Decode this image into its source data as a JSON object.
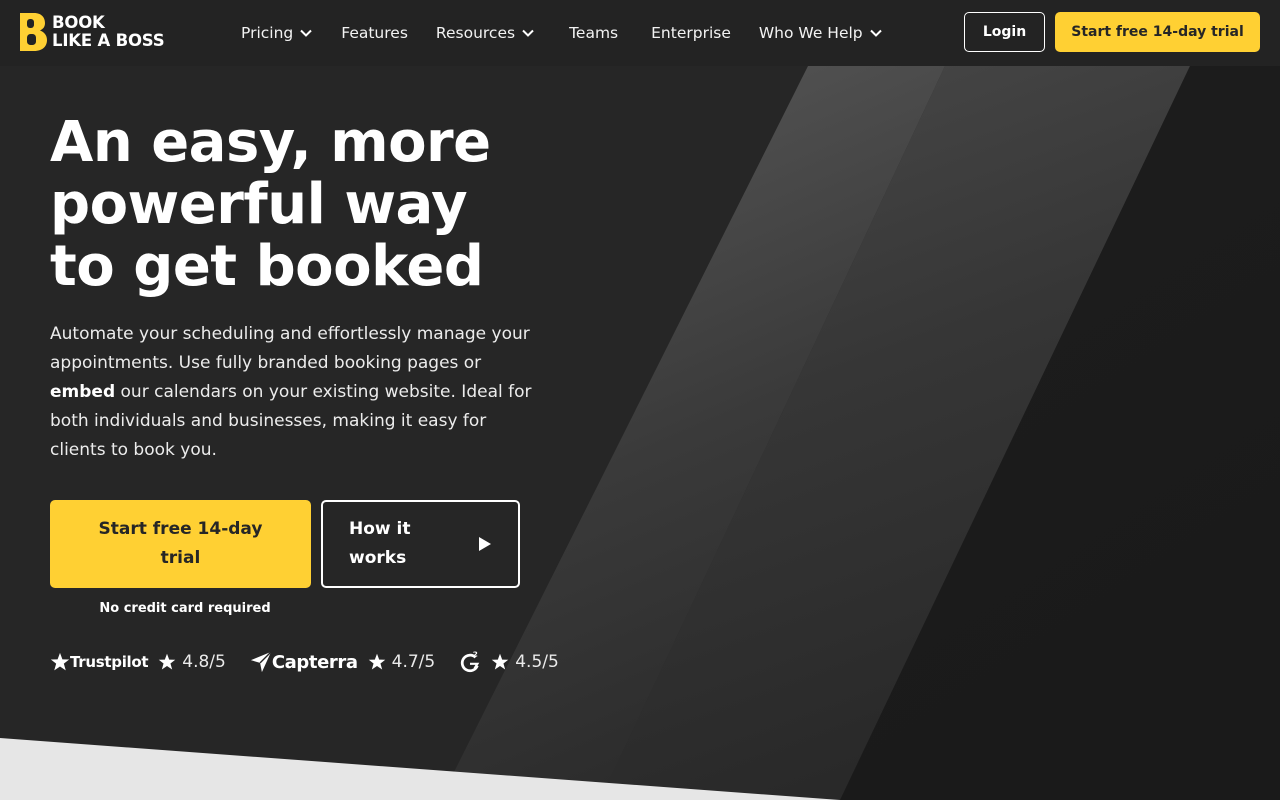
{
  "brand": {
    "logo_line1": "BOOK",
    "logo_line2": "LIKE A BOSS",
    "accent": "#ffd033",
    "background": "#262626"
  },
  "nav": {
    "items": [
      {
        "label": "Pricing",
        "has_dropdown": true
      },
      {
        "label": "Features",
        "has_dropdown": false
      },
      {
        "label": "Resources",
        "has_dropdown": true
      },
      {
        "label": "Teams",
        "has_dropdown": false
      },
      {
        "label": "Enterprise",
        "has_dropdown": false
      },
      {
        "label": "Who We Help",
        "has_dropdown": true
      }
    ],
    "login_label": "Login",
    "trial_label": "Start free 14-day trial"
  },
  "hero": {
    "title": "An easy, more powerful way to get booked",
    "desc_part1": "Automate your scheduling and effortlessly manage your appointments. Use fully branded booking pages or ",
    "desc_bold": "embed",
    "desc_part2": " our calendars on your existing website. Ideal for both individuals and businesses, making it easy for clients to book you.",
    "cta_primary": "Start free 14-day trial",
    "cta_secondary": "How it works",
    "note": "No credit card required"
  },
  "ratings": [
    {
      "source": "Trustpilot",
      "icon": "trustpilot-star-icon",
      "score": "4.8/5"
    },
    {
      "source": "Capterra",
      "icon": "capterra-arrow-icon",
      "score": "4.7/5"
    },
    {
      "source": "G2",
      "icon": "g2-logo-icon",
      "score": "4.5/5"
    }
  ]
}
